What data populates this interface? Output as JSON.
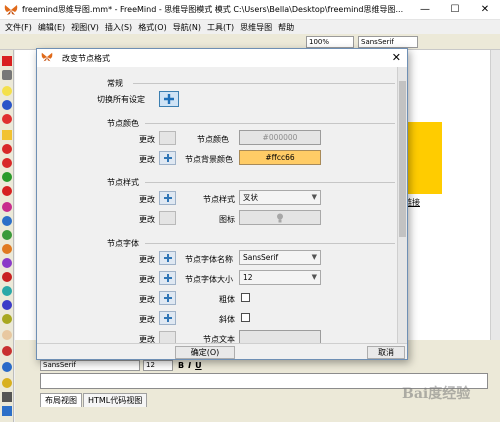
{
  "window": {
    "title": "freemind思维导图.mm* - FreeMind - 思维导图模式 模式 C:\\Users\\Bella\\Desktop\\freemind思维导图..."
  },
  "menubar": [
    "文件(F)",
    "编辑(E)",
    "视图(V)",
    "插入(S)",
    "格式(O)",
    "导航(N)",
    "工具(T)",
    "思维导图",
    "帮助"
  ],
  "toolbar": {
    "zoom": "100%",
    "font": "SansSerif"
  },
  "mindmap": {
    "node_label": "链接"
  },
  "editor": {
    "font": "SansSerif",
    "size": "12",
    "formats": [
      "B",
      "I",
      "U"
    ],
    "tabs": [
      "布局视图",
      "HTML代码视图"
    ]
  },
  "watermark": "Bai度经验",
  "dialog": {
    "title": "改变节点格式",
    "sections": {
      "general": "常规",
      "color": "节点颜色",
      "style": "节点样式",
      "font": "节点字体"
    },
    "labels": {
      "toggle_all": "切换所有设定",
      "change": "更改",
      "node_color": "节点颜色",
      "node_bg_color": "节点背景颜色",
      "node_style": "节点样式",
      "icon": "图标",
      "font_name": "节点字体名称",
      "font_size": "节点字体大小",
      "bold": "粗体",
      "italic": "斜体",
      "node_text": "节点文本"
    },
    "values": {
      "node_color": "#000000",
      "node_bg_color": "#ffcc66",
      "node_style": "叉状",
      "font_name": "SansSerif",
      "font_size": "12"
    },
    "buttons": {
      "ok": "确定(O)",
      "cancel": "取消"
    }
  },
  "colors": {
    "node_bg": "#ffcc00",
    "bg_field": "#ffcc66",
    "accent": "#2e75b6"
  }
}
